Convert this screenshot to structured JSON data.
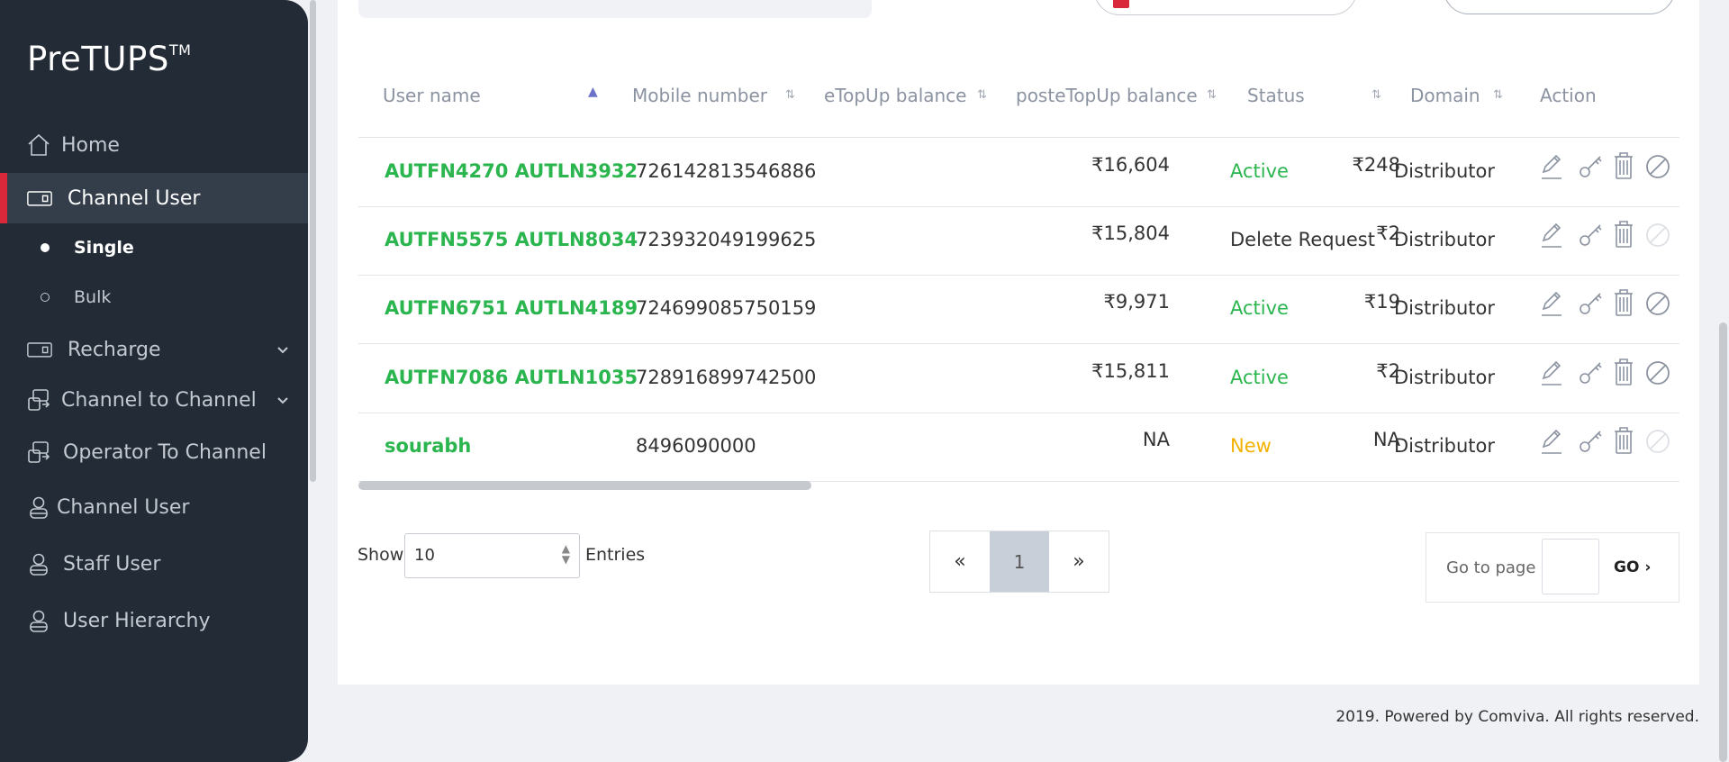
{
  "app": {
    "logo_text": "PreTUPS",
    "logo_tm": "TM"
  },
  "sidebar": {
    "items": [
      {
        "label": "Home",
        "icon": "home-icon"
      },
      {
        "label": "Channel User",
        "icon": "card-icon",
        "active": true
      },
      {
        "label": "Recharge",
        "icon": "card-icon",
        "has_chevron": true
      },
      {
        "label": "Channel to Channel",
        "icon": "transfer-icon",
        "has_chevron": true
      },
      {
        "label": "Operator To Channel",
        "icon": "transfer-icon"
      },
      {
        "label": "Channel User",
        "icon": "user-icon"
      },
      {
        "label": "Staff User",
        "icon": "user-icon"
      },
      {
        "label": "User Hierarchy",
        "icon": "user-icon"
      }
    ],
    "sub_items": [
      {
        "label": "Single",
        "selected": true
      },
      {
        "label": "Bulk",
        "selected": false
      }
    ]
  },
  "table": {
    "headers": {
      "user_name": "User name",
      "mobile": "Mobile number",
      "etopup": "eTopUp balance",
      "postetopup": "posteTopUp balance",
      "status": "Status",
      "domain": "Domain",
      "action": "Action"
    },
    "rows": [
      {
        "name": "AUTFN4270 AUTLN3932",
        "mobile": "726142813546886",
        "etopup": "₹16,604",
        "postetopup": "₹248",
        "status": "Active",
        "status_type": "active",
        "domain": "Distributor",
        "suspend_enabled": true
      },
      {
        "name": "AUTFN5575 AUTLN8034",
        "mobile": "723932049199625",
        "etopup": "₹15,804",
        "postetopup": "₹2",
        "status": "Delete Request",
        "status_type": "del",
        "domain": "Distributor",
        "suspend_enabled": false
      },
      {
        "name": "AUTFN6751 AUTLN4189",
        "mobile": "724699085750159",
        "etopup": "₹9,971",
        "postetopup": "₹19",
        "status": "Active",
        "status_type": "active",
        "domain": "Distributor",
        "suspend_enabled": true
      },
      {
        "name": "AUTFN7086 AUTLN1035",
        "mobile": "728916899742500",
        "etopup": "₹15,811",
        "postetopup": "₹2",
        "status": "Active",
        "status_type": "active",
        "domain": "Distributor",
        "suspend_enabled": true
      },
      {
        "name": "sourabh",
        "mobile": "8496090000",
        "etopup": "NA",
        "postetopup": "NA",
        "status": "New",
        "status_type": "new",
        "domain": "Distributor",
        "suspend_enabled": false
      }
    ]
  },
  "pagination": {
    "show_label": "Show",
    "entries_value": "10",
    "entries_label": "Entries",
    "prev": "«",
    "current_page": "1",
    "next": "»",
    "goto_label": "Go to page",
    "go_label": "GO ›"
  },
  "footer": {
    "copyright": "2019. Powered by Comviva. All rights reserved."
  },
  "colors": {
    "sidebar_bg": "#222b36",
    "accent_red": "#d8283a",
    "active_green": "#2bb54e",
    "new_yellow": "#f3b200"
  }
}
